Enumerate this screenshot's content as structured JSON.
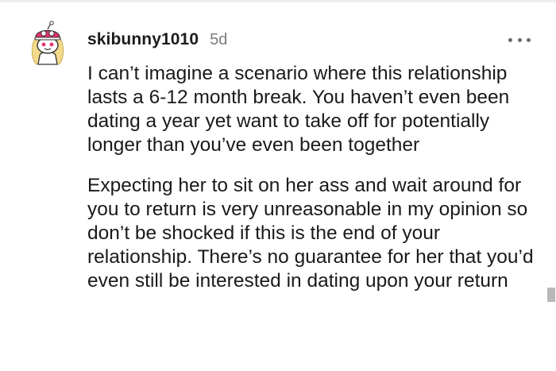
{
  "comment": {
    "username": "skibunny1010",
    "age": "5d",
    "more_icon": "more-horizontal-icon",
    "avatar_icon": "snoo-avatar-icon",
    "paragraphs": [
      "I can’t imagine a scenario where this relationship lasts a 6-12 month break. You haven’t even been dating a year yet want to take off for potentially longer than you’ve even been together",
      "Expecting her to sit on her ass and wait around for you to return is very unreasonable in my opinion so don’t be shocked if this is the end of your relationship. There’s no guarantee for her that you’d even still be interested in dating upon your return"
    ]
  },
  "colors": {
    "text": "#1a1a1b",
    "meta": "#7c7c7c",
    "avatar_accent": "#e8306e",
    "avatar_hair": "#f3d98b"
  }
}
